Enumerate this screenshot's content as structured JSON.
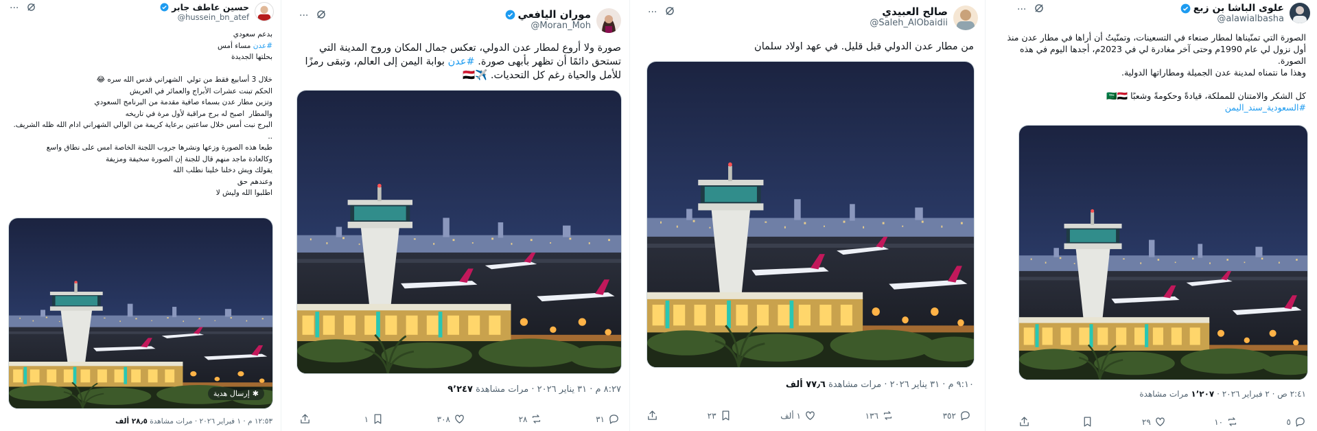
{
  "posts": [
    {
      "name": "علوى الباشا بن زبع",
      "handle": "@alawialbasha",
      "verified": true,
      "avatar_color": "#2c3e50",
      "body_line1": "الصورة التي تمنّيناها لمطار صنعاء في التسعينات، وتمنّيتُ أن أراها في مطار عدن منذ أول نزول لي عام 1990م وحتى آخر مغادرة لي في 2023م، أجدها اليوم في هذه الصورة.",
      "body_line2": "وهذا ما نتمناه لمدينة عدن الجميلة ومطاراتها الدولية.",
      "body_line3": "كل الشكر والامتنان للمملكة، قيادةً وحكومةً وشعبًا 🇸🇦🇾🇪",
      "hashtag": "#السعودية_سند_اليمن",
      "time": "٢:٤١ ص · ٢ فبراير ٢٠٢٦",
      "views_count": "١٬٢٠٧",
      "views_label": "مرات مشاهدة",
      "actions": {
        "replies": "٥",
        "reposts": "١٠",
        "likes": "٢٩",
        "bookmarks": ""
      }
    },
    {
      "name": "صالح العبيدي",
      "handle": "@Saleh_AlObaidii",
      "verified": false,
      "avatar_color": "#c9a27a",
      "body": "من مطار عدن الدولي قبل قليل. في عهد اولاد سلمان",
      "time": "٩:١٠ م · ٣١ يناير ٢٠٢٦",
      "views_count": "٧٧٫٦ ألف",
      "views_label": "مرات مشاهدة",
      "actions": {
        "replies": "٣٥٢",
        "reposts": "١٣٦",
        "likes": "١ ألف",
        "bookmarks": "٢٣"
      }
    },
    {
      "name": "موران اليافعي",
      "handle": "@Moran_Moh",
      "verified": true,
      "avatar_color": "#6d4c41",
      "body_part1": "صورة ولا أروع لمطار عدن الدولي، تعكس جمال المكان وروح المدينة التي تستحق دائمًا أن تظهر بأبهى صورة. ",
      "hashtag": "#عدن",
      "body_part2": " بوابة اليمن إلى العالم، وتبقى رمزًا للأمل والحياة رغم كل التحديات. ✈️🇾🇪",
      "time": "٨:٢٧ م · ٣١ يناير ٢٠٢٦",
      "views_count": "٩٬٢٤٧",
      "views_label": "مرات مشاهدة",
      "actions": {
        "replies": "٣١",
        "reposts": "٢٨",
        "likes": "٣٠٨",
        "bookmarks": "١"
      }
    },
    {
      "name": "حسين عاطف جابر",
      "handle": "@hussein_bn_atef",
      "verified": true,
      "avatar_color": "#b71c1c",
      "intro1": "بدعم سعودي",
      "intro_hashtag": "#عدن",
      "intro2": " مساء أمس",
      "intro3": "بحلتها الجديدة",
      "lines": [
        "خلال 3 أسابيع فقط من تولي  الشهراني قدس الله سره 😂",
        "الحكم تبنت عشرات الأبراج والعمائر في العريش",
        "وتزين مطار عدن بسماء صافية مقدمة من البرنامج السعودي",
        "والمطار  اصبح له برج مراقبة لأول مرة في تاريخه",
        "البرج نبت أمس خلال ساعتين برعاية كريمة من الوالي الشهراني ادام الله ظله الشريف.",
        "..",
        "طبعا هذه الصورة وزعها ونشرها جروب اللجنة الخاصة امس على نطاق واسع",
        "وكالعادة ماجد منهم قال للجنة إن الصورة سخيفة ومزيفة",
        "يقولك ويش دخلنا خلينا نطلب الله",
        "وعندهم حق",
        "اطلبوا الله وليش لا"
      ],
      "gift_label": "إرسال هدية",
      "time": "١٢:٥٣ م · ١ فبراير ٢٠٢٦",
      "views_count": "٢٨٫٥ ألف",
      "views_label": "مرات مشاهدة"
    }
  ]
}
